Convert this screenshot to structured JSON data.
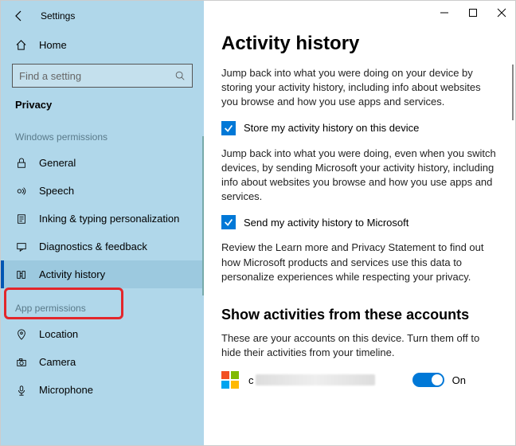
{
  "header": {
    "app_title": "Settings"
  },
  "sidebar": {
    "home_label": "Home",
    "search_placeholder": "Find a setting",
    "section_label": "Privacy",
    "group1_label": "Windows permissions",
    "group2_label": "App permissions",
    "items_win": [
      {
        "label": "General"
      },
      {
        "label": "Speech"
      },
      {
        "label": "Inking & typing personalization"
      },
      {
        "label": "Diagnostics & feedback"
      },
      {
        "label": "Activity history"
      }
    ],
    "items_app": [
      {
        "label": "Location"
      },
      {
        "label": "Camera"
      },
      {
        "label": "Microphone"
      }
    ]
  },
  "main": {
    "title": "Activity history",
    "para1": "Jump back into what you were doing on your device by storing your activity history, including info about websites you browse and how you use apps and services.",
    "check1": "Store my activity history on this device",
    "para2": "Jump back into what you were doing, even when you switch devices, by sending Microsoft your activity history, including info about websites you browse and how you use apps and services.",
    "check2": "Send my activity history to Microsoft",
    "para3": "Review the Learn more and Privacy Statement to find out how Microsoft products and services use this data to personalize experiences while respecting your privacy.",
    "subtitle": "Show activities from these accounts",
    "para4": "These are your accounts on this device. Turn them off to hide their activities from your timeline.",
    "toggle_label": "On",
    "account_prefix": "c"
  }
}
